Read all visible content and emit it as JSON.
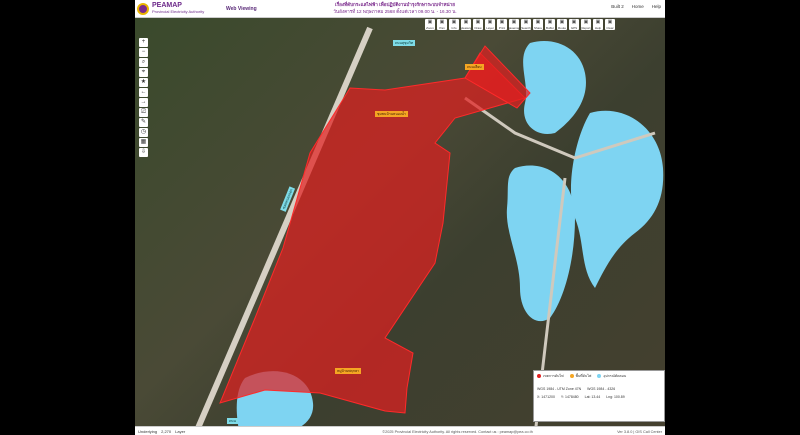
{
  "header": {
    "logo_title": "PEAMAP",
    "logo_sub": "Provincial Electricity Authority",
    "web_viewing": "Web Viewing",
    "banner_line1": "เรื่องที่ดับกระแสไฟฟ้า เพื่อปฏิบัติงานบำรุงรักษาระบบจำหน่าย",
    "banner_line2": "วันอังคารที่ 12 พฤษภาคม 2568 ตั้งแต่เวลา 09.00 น. - 16.30 น.",
    "links": [
      "Built 2",
      "Home",
      "Help"
    ]
  },
  "toolbar": [
    "Zoom",
    "Pan",
    "Info",
    "Measure",
    "Draw",
    "Layer",
    "Print",
    "Basemap",
    "Search",
    "Share",
    "Buffer",
    "Route",
    "GPS",
    "Report",
    "Help",
    "Clear"
  ],
  "sidebar_tools": [
    "+",
    "−",
    "⌕",
    "⌖",
    "★",
    "←",
    "→",
    "⎚",
    "✎",
    "◷",
    "▦",
    "⇩"
  ],
  "map": {
    "outage_area_color": "#e02020",
    "water_color": "#7ed4f2",
    "labels": [
      {
        "text": "ถนนสุขุมวิท",
        "type": "cyan"
      },
      {
        "text": "ซอยหนองจอก",
        "type": "cyan"
      },
      {
        "text": "ถนนเลียบ",
        "type": "orange"
      },
      {
        "text": "ชุมชนบ้านหนองน้ำ",
        "type": "orange"
      },
      {
        "text": "หมู่บ้านพฤกษา",
        "type": "orange"
      },
      {
        "text": "ถนน",
        "type": "cyan"
      }
    ]
  },
  "legend": {
    "item1": "เขตการดับไฟ",
    "item2": "พื้นที่ดับไฟ",
    "item3": "อุปกรณ์ตัดตอน",
    "coord_labels": [
      "WGS 1984 - UTM Zone 47N",
      "WGS 1984 - 4326"
    ],
    "coord_values": [
      "X: 1471200",
      "Y: 1478480",
      "Lat: 13.44",
      "Lng: 100.89"
    ]
  },
  "status": {
    "left": [
      "Underlying",
      "2,270",
      "Layer"
    ],
    "center": "©2025 Provincial Electricity Authority. All rights reserved. Contact us : peamap@pea.co.th",
    "right": "Ver 3.8.0 | GIS Call Center"
  }
}
